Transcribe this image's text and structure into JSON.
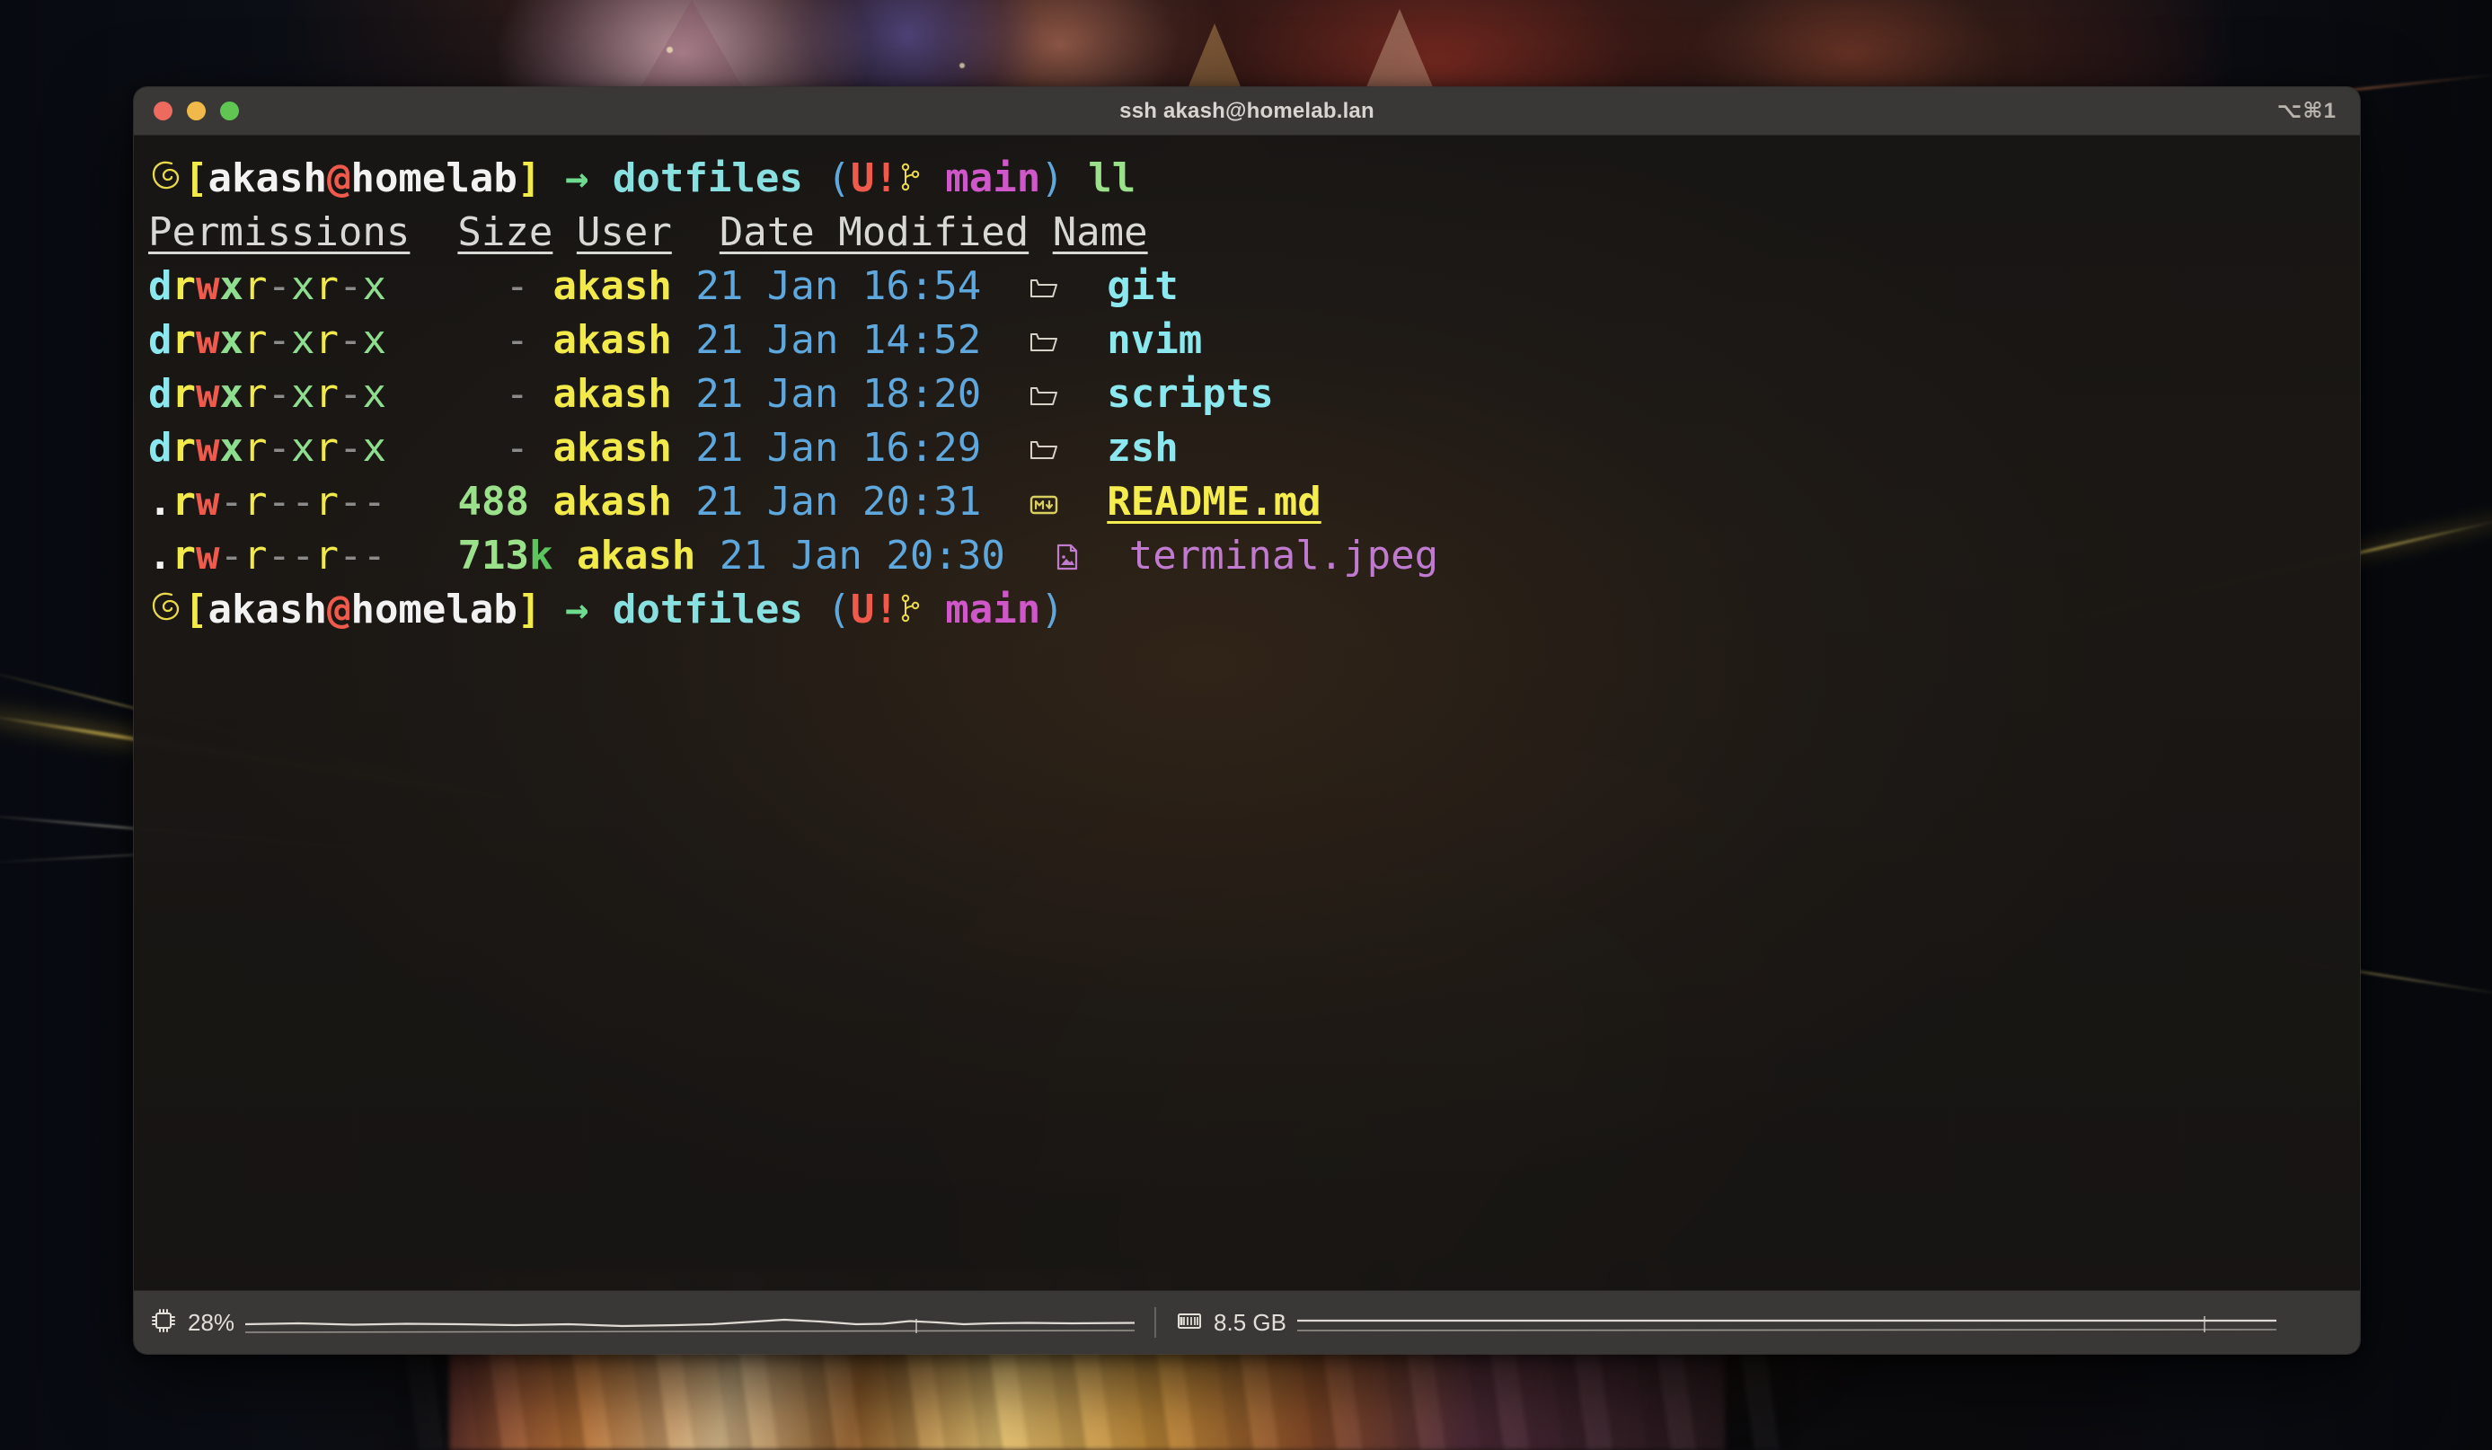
{
  "window": {
    "title": "ssh akash@homelab.lan",
    "shortcut": "⌥⌘1",
    "traffic_lights": [
      {
        "name": "close",
        "color": "#ec6a5e"
      },
      {
        "name": "minimize",
        "color": "#f0b949"
      },
      {
        "name": "maximize",
        "color": "#61c554"
      }
    ]
  },
  "prompt": {
    "os_icon": "debian-swirl-icon",
    "bracket_open": "[",
    "user": "akash",
    "at": "@",
    "host": "homelab",
    "bracket_close": "]",
    "arrow": "→",
    "directory": "dotfiles",
    "git_paren_open": "(",
    "git_dirty": "U!",
    "git_branch_icon": "git-branch-icon",
    "git_branch": "main",
    "git_paren_close": ")",
    "command": "ll"
  },
  "listing": {
    "headers": [
      "Permissions",
      "Size",
      "User",
      "Date Modified",
      "Name"
    ],
    "rows": [
      {
        "perm_type": "d",
        "perm_rest": "rwxr-xr-x",
        "size": "-",
        "size_unit": "",
        "user": "akash",
        "date": "21 Jan 16:54",
        "icon": "folder-icon",
        "name": "git",
        "kind": "directory"
      },
      {
        "perm_type": "d",
        "perm_rest": "rwxr-xr-x",
        "size": "-",
        "size_unit": "",
        "user": "akash",
        "date": "21 Jan 14:52",
        "icon": "folder-icon",
        "name": "nvim",
        "kind": "directory"
      },
      {
        "perm_type": "d",
        "perm_rest": "rwxr-xr-x",
        "size": "-",
        "size_unit": "",
        "user": "akash",
        "date": "21 Jan 18:20",
        "icon": "folder-icon",
        "name": "scripts",
        "kind": "directory"
      },
      {
        "perm_type": "d",
        "perm_rest": "rwxr-xr-x",
        "size": "-",
        "size_unit": "",
        "user": "akash",
        "date": "21 Jan 16:29",
        "icon": "folder-icon",
        "name": "zsh",
        "kind": "directory"
      },
      {
        "perm_type": ".",
        "perm_rest": "rw-r--r--",
        "size": "488",
        "size_unit": "",
        "user": "akash",
        "date": "21 Jan 20:31",
        "icon": "markdown-file-icon",
        "name": "README.md",
        "kind": "markdown"
      },
      {
        "perm_type": ".",
        "perm_rest": "rw-r--r--",
        "size": "713",
        "size_unit": "k",
        "user": "akash",
        "date": "21 Jan 20:30",
        "icon": "image-file-icon",
        "name": "terminal.jpeg",
        "kind": "image"
      }
    ]
  },
  "statusbar": {
    "cpu": {
      "icon": "cpu-chip-icon",
      "value": "28%"
    },
    "memory": {
      "icon": "memory-stick-icon",
      "value": "8.5 GB"
    }
  },
  "colors": {
    "perm_dir": "#8ce8ef",
    "perm_read": "#f2e94b",
    "perm_write": "#ef5a4c",
    "perm_exec": "#8fdd8f",
    "perm_none": "#8b8b8b",
    "user": "#f2e94b",
    "date": "#5fa8dd",
    "size": "#9be08a",
    "size_unit": "#5ec45e",
    "dir_name": "#8ce8ef",
    "markdown_name": "#f5ec4e",
    "image_name": "#c07bd0",
    "prompt_user": "#f2f2f2",
    "prompt_at": "#ef5a4c",
    "prompt_bracket": "#f2e94b",
    "prompt_arrow": "#6edb8f",
    "prompt_dir": "#89e0e0",
    "git_branch": "#cf57c9",
    "git_dirty": "#ef5a4c",
    "command": "#9be08a",
    "titlebar": "#3a3836"
  }
}
